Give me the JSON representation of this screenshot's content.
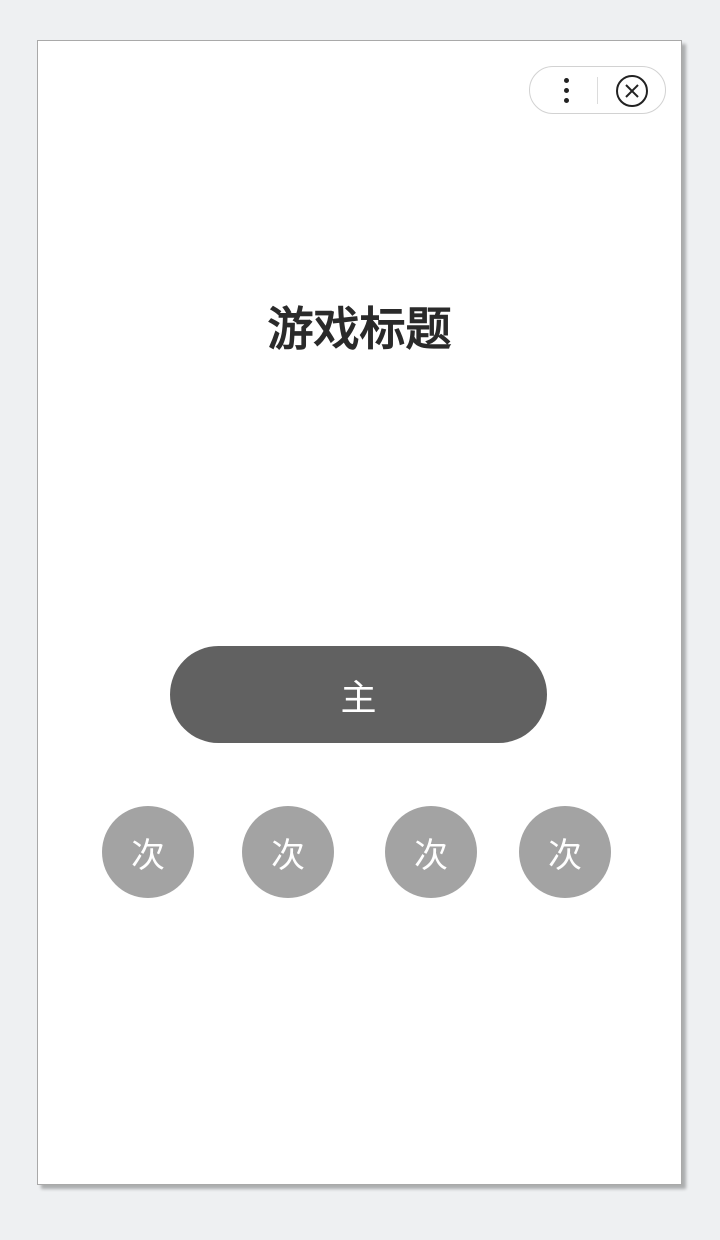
{
  "capsule": {
    "more_icon": "more-vertical-icon",
    "close_icon": "close-circle-icon"
  },
  "game": {
    "title": "游戏标题",
    "primary_button": "主",
    "secondary_buttons": [
      "次",
      "次",
      "次",
      "次"
    ]
  },
  "colors": {
    "background": "#eef0f2",
    "primary_button": "#616161",
    "secondary_button": "#a3a3a3",
    "title_text": "#2a2a2a"
  }
}
